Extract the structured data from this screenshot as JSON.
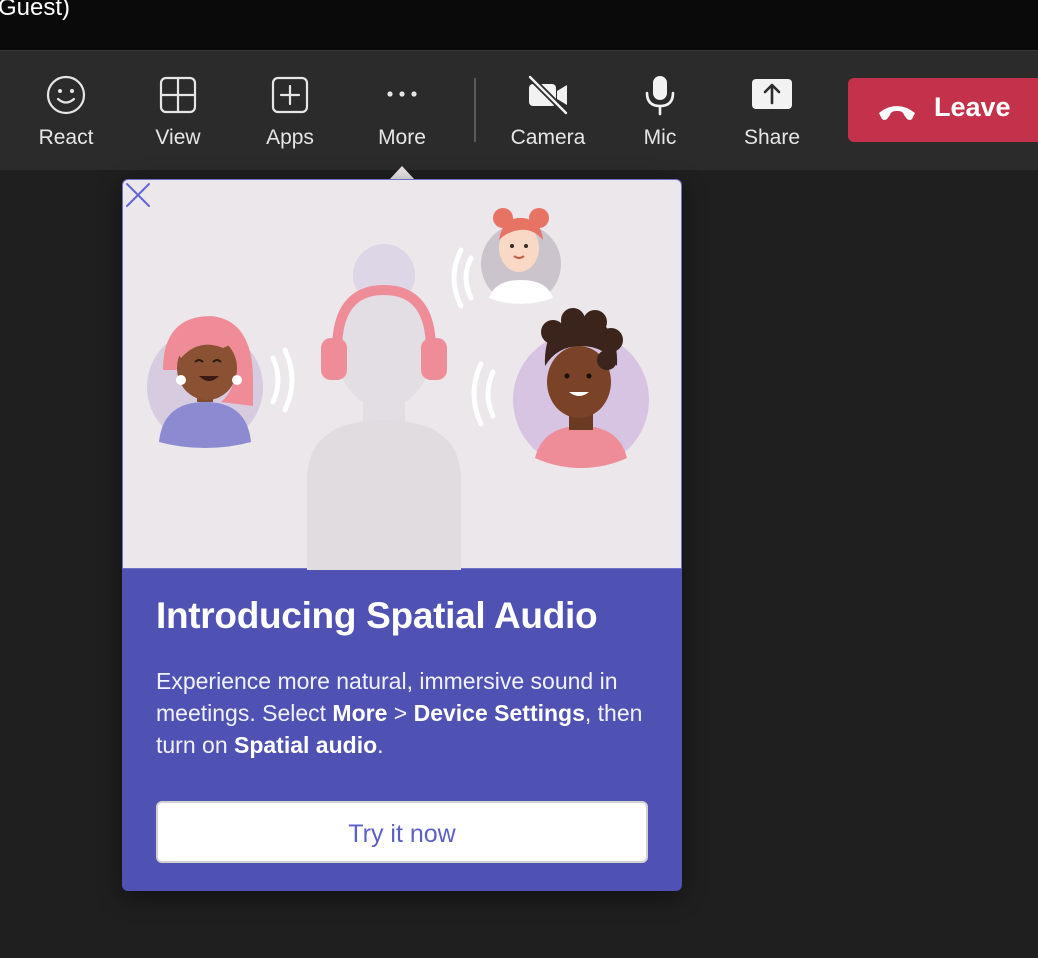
{
  "window": {
    "title": "Guest)"
  },
  "toolbar": {
    "items": [
      {
        "label": "React",
        "icon": "smiley-icon"
      },
      {
        "label": "View",
        "icon": "grid-icon"
      },
      {
        "label": "Apps",
        "icon": "plus-box-icon"
      },
      {
        "label": "More",
        "icon": "more-dots-icon"
      },
      {
        "label": "Camera",
        "icon": "camera-off-icon"
      },
      {
        "label": "Mic",
        "icon": "microphone-icon"
      },
      {
        "label": "Share",
        "icon": "share-upload-icon"
      }
    ],
    "leave": {
      "label": "Leave",
      "icon": "hang-up-phone-icon",
      "color": "#c4314b"
    }
  },
  "popup": {
    "title": "Introducing Spatial Audio",
    "body": {
      "part1": "Experience more natural, immersive sound in meetings. Select ",
      "bold1": "More",
      "part2": " > ",
      "bold2": "Device Settings",
      "part3": ", then turn on ",
      "bold3": "Spatial audio",
      "part4": "."
    },
    "button_label": "Try it now",
    "accent_color": "#4f52b2"
  }
}
